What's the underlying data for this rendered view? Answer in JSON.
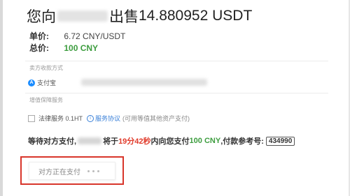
{
  "order": {
    "title_prefix": "您向",
    "title_middle": "出售",
    "amount": "14.880952",
    "currency": "USDT",
    "unit_price_label": "单价:",
    "unit_price_value": "6.72 CNY/USDT",
    "total_label": "总价:",
    "total_value": "100 CNY"
  },
  "payment": {
    "section_title": "卖方收款方式",
    "method_icon": "A",
    "method_label": "支付宝"
  },
  "service": {
    "section_title": "增值保障服务",
    "legal_label": "法律服务 0.1HT",
    "agreement_link": "服务协议",
    "note": "(可用等值其他资产支付)"
  },
  "waiting": {
    "text_1": "等待对方支付,",
    "text_2": "将于",
    "countdown": "19分42秒",
    "text_3": "内向您支付",
    "amount": "100 CNY",
    "text_4": ",付款参考号:",
    "reference": "434990"
  },
  "status": {
    "label": "对方正在支付"
  }
}
